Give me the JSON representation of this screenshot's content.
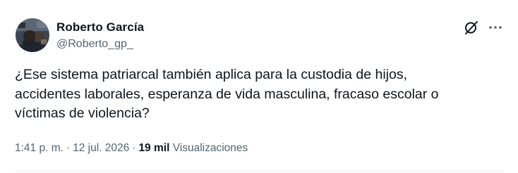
{
  "author": {
    "display_name": "Roberto García",
    "handle": "@Roberto_gp_",
    "avatar_icon": "user-avatar"
  },
  "tweet": {
    "text": "¿Ese sistema patriarcal también aplica para la custodia de hijos,\naccidentes laborales, esperanza de vida masculina, fracaso escolar o\nvíctimas de violencia?"
  },
  "meta": {
    "time": "1:41 p. m.",
    "separator": "·",
    "date": "12 jul. 2026",
    "views_count": "19 mil",
    "views_label": "Visualizaciones"
  },
  "actions": {
    "grok_icon": "grok-icon",
    "more_icon": "more-options-icon"
  },
  "colors": {
    "text_primary": "#0f1419",
    "text_secondary": "#536471",
    "divider": "#eff3f4"
  }
}
